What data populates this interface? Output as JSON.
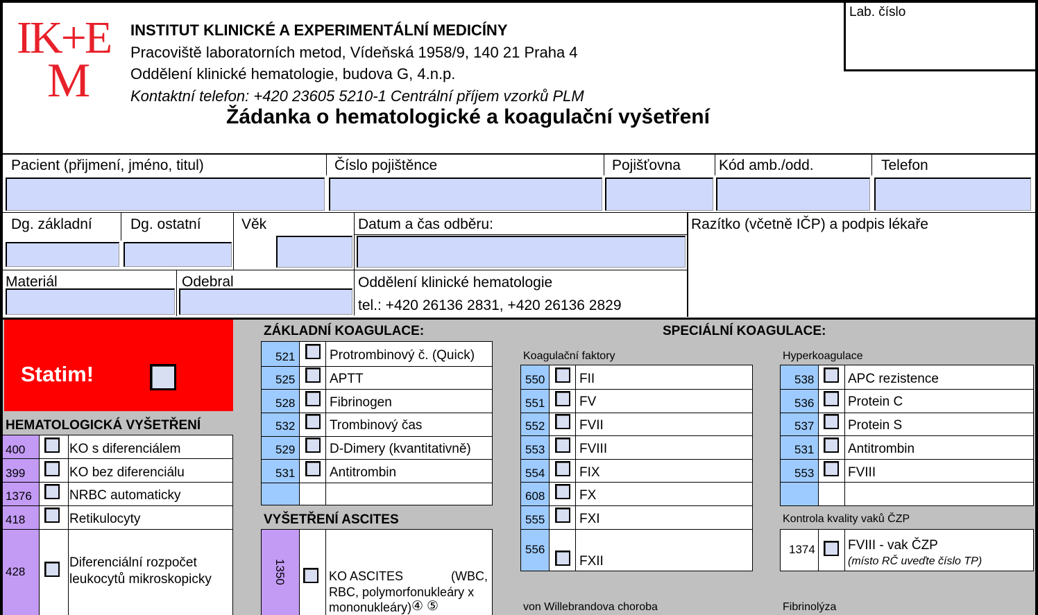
{
  "header": {
    "logo_text": "IKEM",
    "logo_lines": [
      "IK+E",
      "M"
    ],
    "institute": "INSTITUT KLINICKÉ A EXPERIMENTÁLNÍ MEDICÍNY",
    "address": "Pracoviště laboratorních metod, Vídeňská 1958/9, 140 21 Praha 4",
    "department": "Oddělení klinické hematologie, budova G, 4.n.p.",
    "contact": "Kontaktní telefon: +420 23605 5210-1 Centrální příjem vzorků PLM",
    "form_title": "Žádanka o hematologické a koagulační vyšetření",
    "lab_number_label": "Lab. číslo",
    "brand_color": "#e8202a"
  },
  "patient": {
    "name_label": "Pacient (přijmení, jméno, titul)",
    "insurance_no_label": "Číslo pojištěnce",
    "insurer_label": "Pojišťovna",
    "ward_code_label": "Kód amb./odd.",
    "phone_label": "Telefon",
    "dg_main_label": "Dg. základní",
    "dg_other_label": "Dg. ostatní",
    "age_label": "Věk",
    "datetime_label": "Datum a čas odběru:",
    "stamp_label": "Razítko (včetně IČP) a podpis lékaře",
    "material_label": "Materiál",
    "collected_by_label": "Odebral",
    "dept_name": "Oddělení klinické hematologie",
    "dept_phone": "tel.: +420 26136 2831, +420 26136 2829"
  },
  "statim": {
    "label": "Statim!",
    "color": "#ff0000"
  },
  "hematology": {
    "title": "HEMATOLOGICKÁ VYŠETŘENÍ",
    "code_color": "#c39bf5",
    "items": [
      {
        "code": "400",
        "label": "KO s diferenciálem"
      },
      {
        "code": "399",
        "label": "KO bez diferenciálu"
      },
      {
        "code": "1376",
        "label": "NRBC automaticky"
      },
      {
        "code": "418",
        "label": "Retikulocyty"
      },
      {
        "code": "428",
        "label_line1": "Diferenciální rozpočet",
        "label_line2": "leukocytů mikroskopicky"
      }
    ]
  },
  "basic_coag": {
    "title": "ZÁKLADNÍ KOAGULACE:",
    "code_color": "#9ecbff",
    "items": [
      {
        "code": "521",
        "label": "Protrombinový č. (Quick)"
      },
      {
        "code": "525",
        "label": "APTT"
      },
      {
        "code": "528",
        "label": "Fibrinogen"
      },
      {
        "code": "532",
        "label": "Trombinový čas"
      },
      {
        "code": "529",
        "label": "D-Dimery (kvantitativně)"
      },
      {
        "code": "531",
        "label": "Antitrombin"
      }
    ]
  },
  "ascites": {
    "title": "VYŠETŘENÍ ASCITES",
    "code": "1350",
    "label_line1": "KO ASCITES",
    "label_line1b": "(WBC,",
    "label_line2": "RBC, polymorfonukleáry x",
    "label_line3": "mononukleáry)",
    "markers": [
      "④",
      "⑤"
    ]
  },
  "special_coag": {
    "title": "SPECIÁLNÍ KOAGULACE:",
    "factors_title": "Koagulační faktory",
    "factors": [
      {
        "code": "550",
        "label": "FII"
      },
      {
        "code": "551",
        "label": "FV"
      },
      {
        "code": "552",
        "label": "FVII"
      },
      {
        "code": "553",
        "label": "FVIII"
      },
      {
        "code": "554",
        "label": "FIX"
      },
      {
        "code": "608",
        "label": "FX"
      },
      {
        "code": "555",
        "label": "FXI"
      },
      {
        "code": "556",
        "label": "FXII"
      }
    ],
    "hyper_title": "Hyperkoagulace",
    "hyper": [
      {
        "code": "538",
        "label": "APC rezistence"
      },
      {
        "code": "536",
        "label": "Protein C"
      },
      {
        "code": "537",
        "label": "Protein S"
      },
      {
        "code": "531",
        "label": "Antitrombin"
      },
      {
        "code": "553",
        "label": "FVIII"
      }
    ],
    "qc_title": "Kontrola kvality vaků ČZP",
    "qc_code": "1374",
    "qc_label": "FVIII - vak ČZP",
    "qc_note": "(místo RČ uveďte číslo TP)",
    "vwd_title": "von Willebrandova choroba",
    "fibrinolysis_title": "Fibrinolýza"
  }
}
